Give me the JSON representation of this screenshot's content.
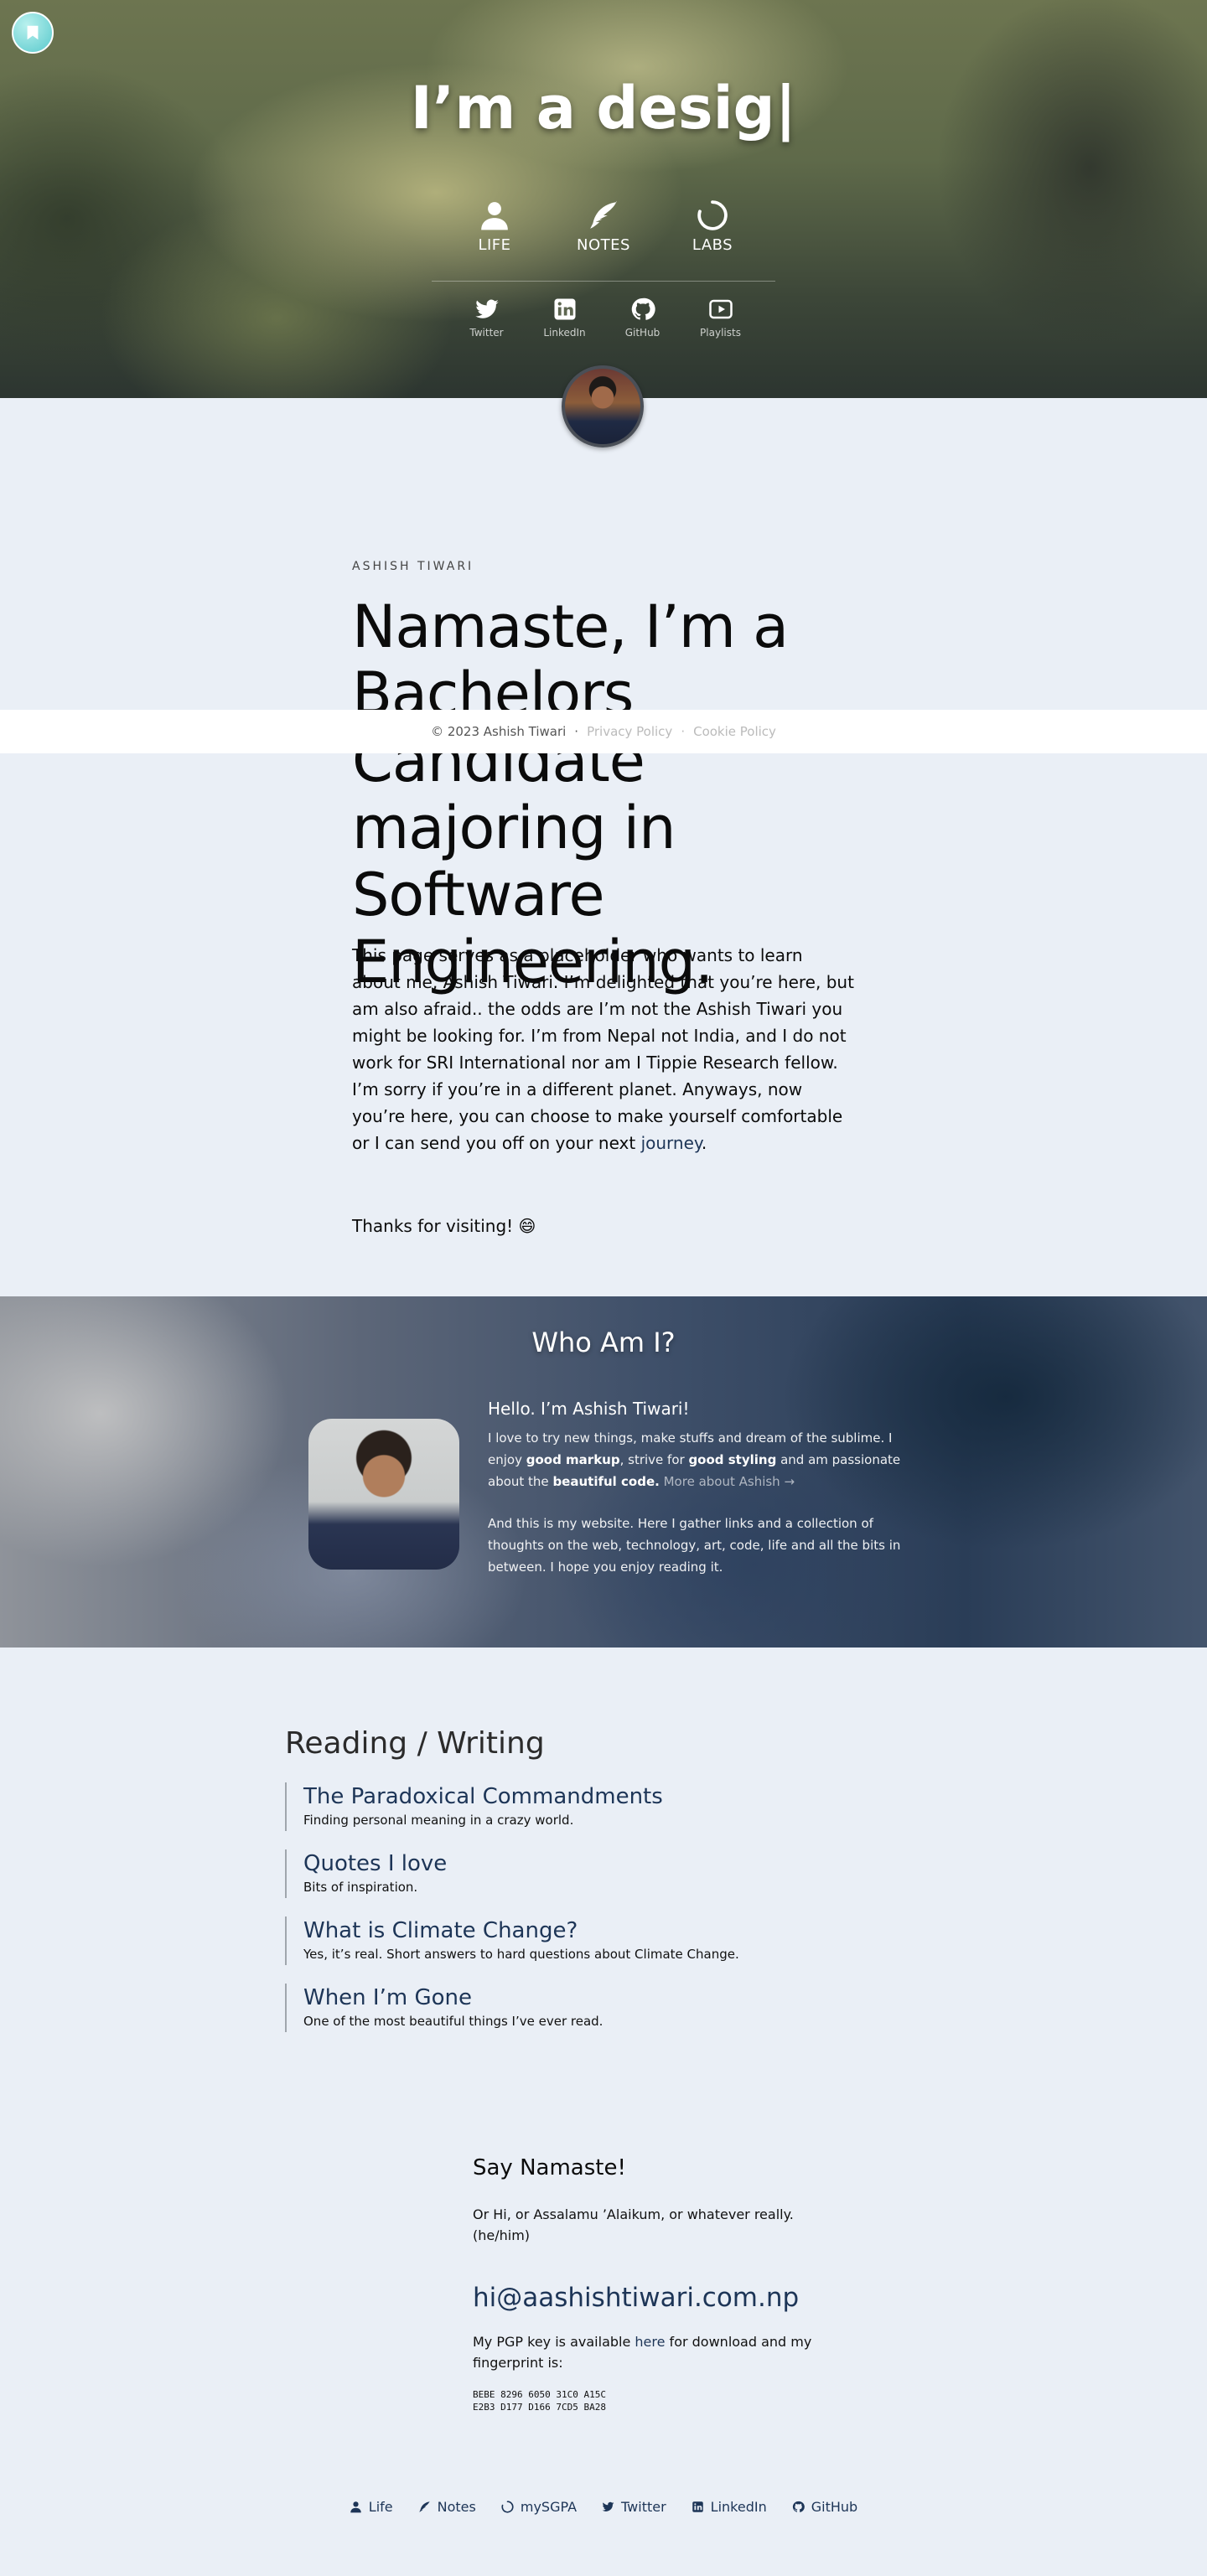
{
  "hero": {
    "typed_title": "I’m a desig|",
    "nav": [
      {
        "label": "LIFE",
        "icon": "person-icon"
      },
      {
        "label": "NOTES",
        "icon": "feather-icon"
      },
      {
        "label": "LABS",
        "icon": "spinner-icon"
      }
    ],
    "social": [
      {
        "label": "Twitter",
        "icon": "twitter-icon"
      },
      {
        "label": "LinkedIn",
        "icon": "linkedin-icon"
      },
      {
        "label": "GitHub",
        "icon": "github-icon"
      },
      {
        "label": "Playlists",
        "icon": "play-icon"
      }
    ]
  },
  "about": {
    "eyebrow": "ASHISH TIWARI",
    "headline": "Namaste, I’m a Bachelors Candidate majoring in Software Engineering.",
    "intro_text": "This page serves as a placeholder who wants to learn about me, Ashish Tiwari. I’m delighted that you’re here, but am also afraid.. the odds are I’m not the Ashish Tiwari you might be looking for. I’m from Nepal not India, and I do not work for SRI International nor am I Tippie Research fellow. I’m sorry if you’re in a different planet. Anyways, now you’re here, you can choose to make yourself comfortable or I can send you off on your next ",
    "intro_link": "journey",
    "intro_end": ".",
    "thanks": "Thanks for visiting! 😄"
  },
  "cookie_bar": {
    "copyright": "© 2023 Ashish Tiwari",
    "sep1": "·",
    "privacy": "Privacy Policy",
    "sep2": "·",
    "cookie": "Cookie Policy"
  },
  "who": {
    "title": "Who Am I?",
    "hello": "Hello. I’m Ashish Tiwari!",
    "p1_a": "I love to try new things, make stuffs and dream of the sublime. I enjoy ",
    "p1_b1": "good markup",
    "p1_c": ", strive for ",
    "p1_b2": "good styling",
    "p1_d": " and am passionate about the ",
    "p1_b3": "beautiful code.",
    "p1_more": " More about Ashish →",
    "p2": "And this is my website. Here I gather links and a collection of thoughts on the web, technology, art, code, life and all the bits in between. I hope you enjoy reading it."
  },
  "reading": {
    "heading": "Reading / Writing",
    "items": [
      {
        "title": "The Paradoxical Commandments",
        "desc": "Finding personal meaning in a crazy world."
      },
      {
        "title": "Quotes I love",
        "desc": "Bits of inspiration."
      },
      {
        "title": "What is Climate Change?",
        "desc": "Yes, it’s real. Short answers to hard questions about Climate Change."
      },
      {
        "title": "When I’m Gone",
        "desc": "One of the most beautiful things I’ve ever read."
      }
    ]
  },
  "contact": {
    "heading": "Say Namaste!",
    "greeting": "Or Hi, or Assalamu ’Alaikum, or whatever really. (he/him)",
    "email": "hi@aashishtiwari.com.np",
    "pgp_a": "My PGP key is available ",
    "pgp_link": "here",
    "pgp_b": " for download and my fingerprint is:",
    "fingerprint_1": "BEBE 8296 6050 31C0 A15C",
    "fingerprint_2": "E2B3 D177 D166 7CD5 BA28"
  },
  "footer": {
    "links": [
      {
        "label": "Life",
        "icon": "person-icon"
      },
      {
        "label": "Notes",
        "icon": "feather-icon"
      },
      {
        "label": "mySGPA",
        "icon": "spinner-icon"
      },
      {
        "label": "Twitter",
        "icon": "twitter-icon"
      },
      {
        "label": "LinkedIn",
        "icon": "linkedin-icon"
      },
      {
        "label": "GitHub",
        "icon": "github-icon"
      }
    ]
  },
  "colors": {
    "page_bg": "#eaeff6",
    "link": "#1d3557",
    "badge": "#59c9cc"
  }
}
